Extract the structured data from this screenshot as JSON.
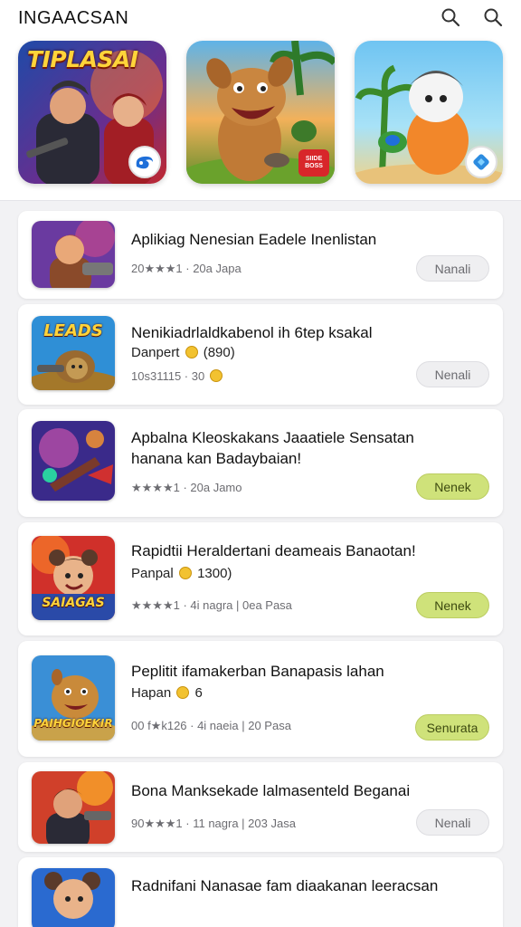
{
  "header": {
    "title": "INGAACSAN"
  },
  "featured": [
    {
      "title": "TIPLASAI"
    },
    {
      "tag": "SIIDE BOSS"
    },
    {
      "title": ""
    }
  ],
  "apps": [
    {
      "title": "Aplikiag Nenesian Eadele Inenlistan",
      "meta": "20★★★1 · 20a Japa",
      "button": "Nanali"
    },
    {
      "thumb": "LEADS",
      "title": "Nenikiadrlaldkabenol ih 6tep ksakal",
      "sub": "Danpert",
      "sub_after": "(890)",
      "meta": "10s31115 · 30",
      "button": "Nenali"
    },
    {
      "title": "Apbalna Kleoskakans Jaaatiele Sensatan",
      "title2": "hanana kan Badaybaian!",
      "meta": "★★★★1 · 20a Jamo",
      "button": "Nenek"
    },
    {
      "thumb": "SAIAGAS",
      "title": "Rapidtii Heraldertani deameais Banaotan!",
      "sub": "Panpal",
      "sub_after": "1300)",
      "meta": "★★★★1 · 4i nagra | 0ea Pasa",
      "button": "Nenek"
    },
    {
      "thumb": "PAIHGIOEKIR",
      "title": "Peplitit ifamakerban Banapasis lahan",
      "sub": "Hapan",
      "sub_after": "6",
      "meta": "00 f★k126 · 4i naeia | 20 Pasa",
      "button": "Senurata"
    },
    {
      "title": "Bona Manksekade lalmasenteld Beganai",
      "meta": "90★★★1 · 11 nagra | 203 Jasa",
      "button": "Nenali"
    },
    {
      "title": "Radnifani Nanasae fam diaakanan leeracsan",
      "meta": ""
    }
  ]
}
